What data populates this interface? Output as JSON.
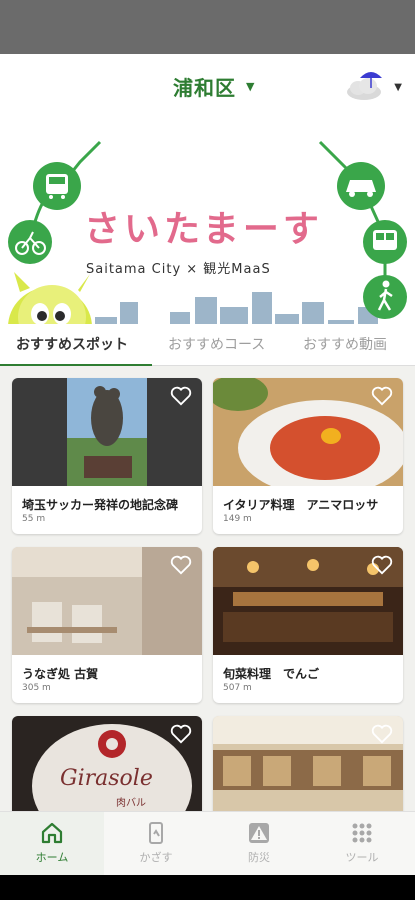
{
  "header": {
    "district": "浦和区",
    "district_caret": "▼",
    "weather_caret": "▼"
  },
  "banner": {
    "logo_text": "さいたまーす",
    "subtitle": "Saitama City × 観光MaaS"
  },
  "tabs": [
    {
      "label": "おすすめスポット",
      "active": true
    },
    {
      "label": "おすすめコース",
      "active": false
    },
    {
      "label": "おすすめ動画",
      "active": false
    }
  ],
  "spots": [
    {
      "title": "埼玉サッカー発祥の地記念碑",
      "distance": "55 m"
    },
    {
      "title": "イタリア料理　アニマロッサ",
      "distance": "149 m"
    },
    {
      "title": "うなぎ処 古賀",
      "distance": "305 m"
    },
    {
      "title": "旬菜料理　でんご",
      "distance": "507 m"
    },
    {
      "title": "",
      "distance": "",
      "sign": "Girasole",
      "sign_sub": "肉バル"
    },
    {
      "title": "",
      "distance": ""
    }
  ],
  "bottom_nav": [
    {
      "label": "ホーム",
      "icon": "home-icon",
      "active": true
    },
    {
      "label": "かざす",
      "icon": "scan-phone-icon",
      "active": false
    },
    {
      "label": "防災",
      "icon": "warning-icon",
      "active": false
    },
    {
      "label": "ツール",
      "icon": "grid-icon",
      "active": false
    }
  ],
  "colors": {
    "accent": "#2e7d32",
    "banner_green": "#3aa64a",
    "logo_pink": "#e26a8c"
  }
}
